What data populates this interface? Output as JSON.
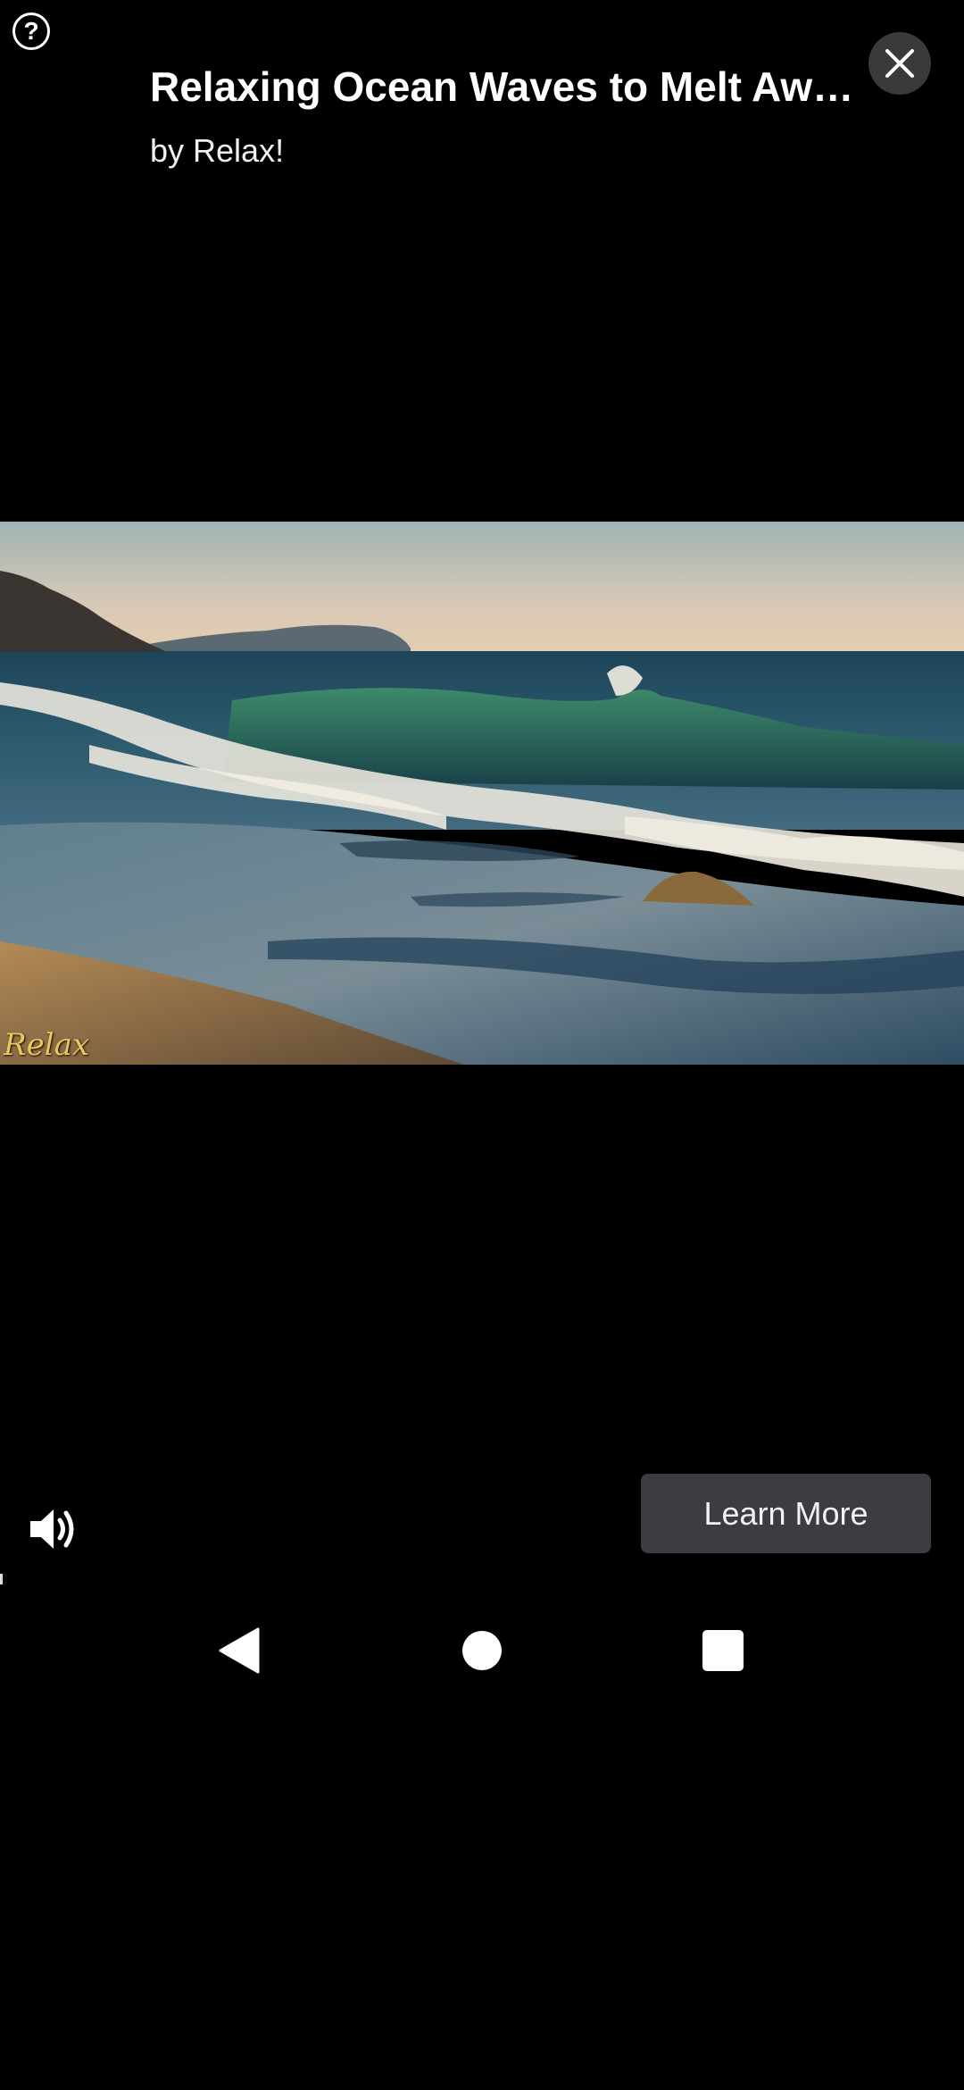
{
  "ad": {
    "title": "Relaxing Ocean Waves to Melt Awa…",
    "byline": "by Relax!",
    "help_glyph": "?",
    "close_icon": "close-icon"
  },
  "video": {
    "watermark": "Relax",
    "scene": "ocean-waves-sunset"
  },
  "controls": {
    "volume_icon": "volume-on-icon",
    "learn_more_label": "Learn More"
  },
  "navigation": {
    "back_icon": "back-triangle-icon",
    "home_icon": "home-circle-icon",
    "recents_icon": "recents-square-icon"
  },
  "colors": {
    "background": "#000000",
    "button_bg": "#3b3d40",
    "close_bg": "#3a3a3a",
    "watermark": "#e8c95a"
  }
}
